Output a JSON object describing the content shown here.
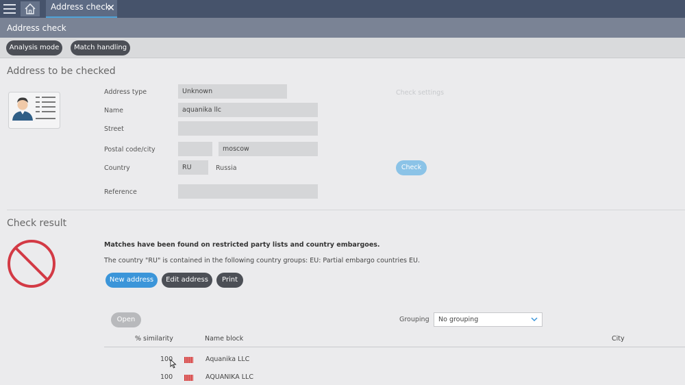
{
  "app": {
    "tab_label": "Address check",
    "page_title": "Address check"
  },
  "toolbar": {
    "analysis_mode": "Analysis mode",
    "match_handling": "Match handling"
  },
  "address": {
    "section_title": "Address to be checked",
    "address_type_label": "Address type",
    "address_type_value": "Unknown",
    "name_label": "Name",
    "name_value": "aquanika llc",
    "street_label": "Street",
    "street_value": "",
    "postal_label": "Postal code/city",
    "postal_value": "",
    "city_value": "moscow",
    "country_label": "Country",
    "country_code": "RU",
    "country_name": "Russia",
    "reference_label": "Reference",
    "reference_value": "",
    "check_settings": "Check settings",
    "check_button": "Check"
  },
  "result": {
    "section_title": "Check result",
    "message": "Matches have been found on restricted party lists and country embargoes.",
    "detail": "The country \"RU\" is contained in the following country groups: EU: Partial embargo countries EU.",
    "new_address": "New address",
    "edit_address": "Edit address",
    "print": "Print",
    "open": "Open",
    "grouping_label": "Grouping",
    "grouping_value": "No grouping"
  },
  "table": {
    "columns": [
      "% similarity",
      "Name block",
      "City"
    ],
    "rows": [
      {
        "similarity": "100",
        "name": "Aquanika LLC",
        "city": ""
      },
      {
        "similarity": "100",
        "name": "AQUANIKA LLC",
        "city": ""
      }
    ]
  },
  "colors": {
    "topbar": "#46536b",
    "accent": "#3b95d9",
    "danger": "#d33a45"
  }
}
